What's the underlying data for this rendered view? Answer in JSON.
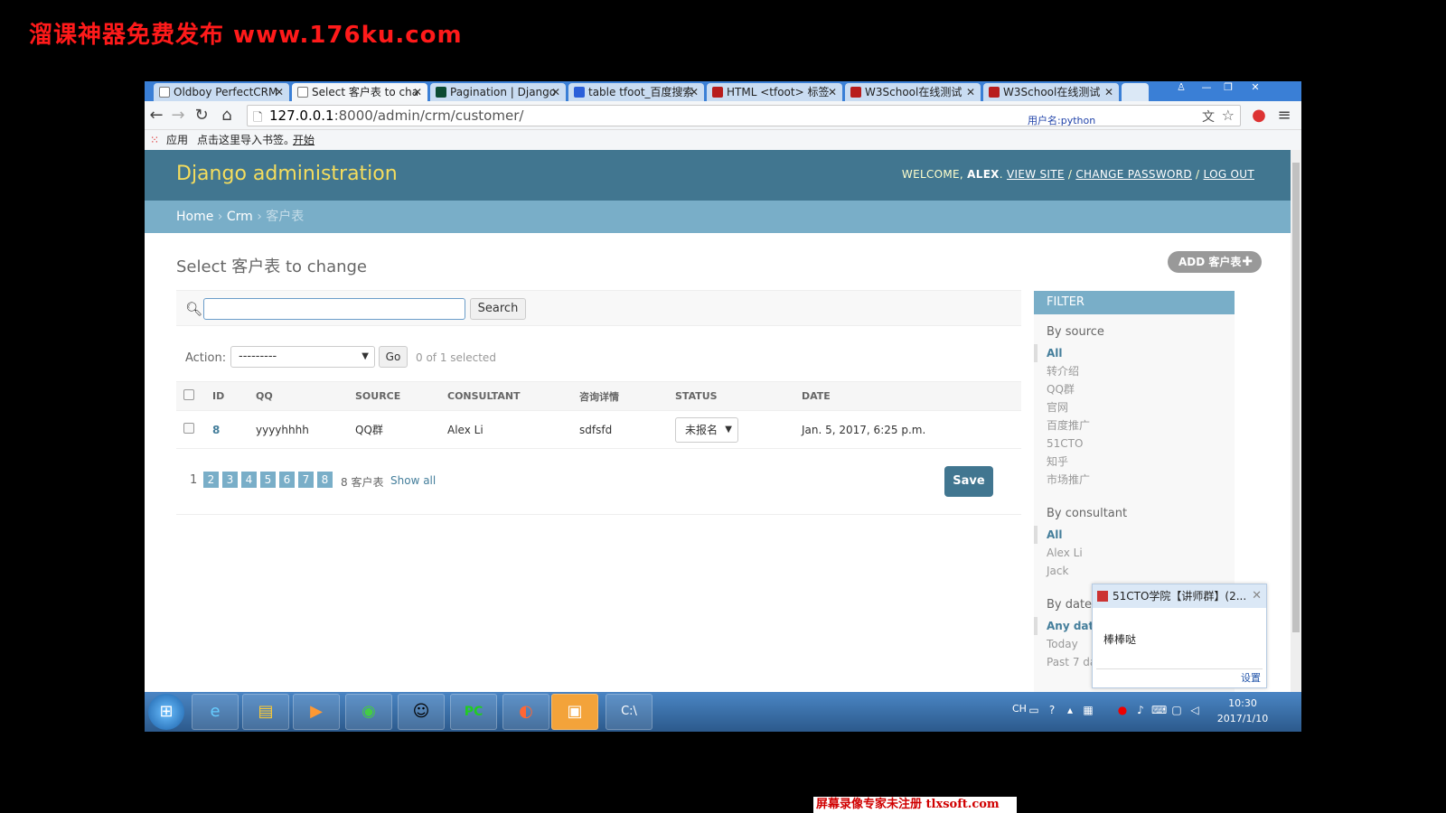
{
  "watermarks": {
    "top": "溜课神器免费发布 www.176ku.com",
    "bottom": "屏幕录像专家未注册 tlxsoft.com"
  },
  "browser": {
    "tabs": [
      {
        "label": "Oldboy PerfectCRM",
        "active": false
      },
      {
        "label": "Select 客户表 to cha",
        "active": true
      },
      {
        "label": "Pagination | Django",
        "active": false
      },
      {
        "label": "table tfoot_百度搜索",
        "active": false
      },
      {
        "label": "HTML <tfoot> 标签",
        "active": false
      },
      {
        "label": "W3School在线测试",
        "active": false
      },
      {
        "label": "W3School在线测试",
        "active": false
      }
    ],
    "url_host": "127.0.0.1",
    "url_rest": ":8000/admin/crm/customer/",
    "user_tip": "用户名:python",
    "bookmarks": {
      "apps": "应用",
      "import": "点击这里导入书签。",
      "start": "开始"
    }
  },
  "admin": {
    "site_title": "Django administration",
    "welcome": "WELCOME,",
    "username": "ALEX",
    "view_site": "VIEW SITE",
    "change_password": "CHANGE PASSWORD",
    "log_out": "LOG OUT",
    "breadcrumb": {
      "home": "Home",
      "app": "Crm",
      "model": "客户表"
    },
    "content_title": "Select 客户表 to change",
    "add_button": "ADD 客户表",
    "search_button": "Search",
    "search_value": "",
    "action_label": "Action:",
    "action_select": "---------",
    "go_button": "Go",
    "selected_count": "0 of 1 selected",
    "columns": [
      "ID",
      "QQ",
      "SOURCE",
      "CONSULTANT",
      "咨询详情",
      "STATUS",
      "DATE"
    ],
    "rows": [
      {
        "id": "8",
        "qq": "yyyyhhhh",
        "source": "QQ群",
        "consultant": "Alex Li",
        "detail": "sdfsfd",
        "status": "未报名",
        "date": "Jan. 5, 2017, 6:25 p.m."
      }
    ],
    "pagination": {
      "current": "1",
      "pages": [
        "2",
        "3",
        "4",
        "5",
        "6",
        "7",
        "8"
      ],
      "result_count": "8 客户表",
      "show_all": "Show all"
    },
    "save_button": "Save",
    "filter": {
      "title": "FILTER",
      "groups": [
        {
          "title": "By source",
          "items": [
            "All",
            "转介绍",
            "QQ群",
            "官网",
            "百度推广",
            "51CTO",
            "知乎",
            "市场推广"
          ]
        },
        {
          "title": "By consultant",
          "items": [
            "All",
            "Alex Li",
            "Jack"
          ]
        },
        {
          "title": "By date",
          "items": [
            "Any date",
            "Today",
            "Past 7 days"
          ]
        }
      ]
    }
  },
  "qq_popup": {
    "title": "51CTO学院【讲师群】(2...",
    "message": "棒棒哒",
    "settings": "设置"
  },
  "taskbar": {
    "lang": "CH",
    "time": "10:30",
    "date": "2017/1/10"
  },
  "colors": {
    "header": "#417690",
    "breadcrumbs": "#79aec8",
    "site_title": "#f5dd5d",
    "link": "#447e9b",
    "watermark": "#ff1a1a"
  }
}
